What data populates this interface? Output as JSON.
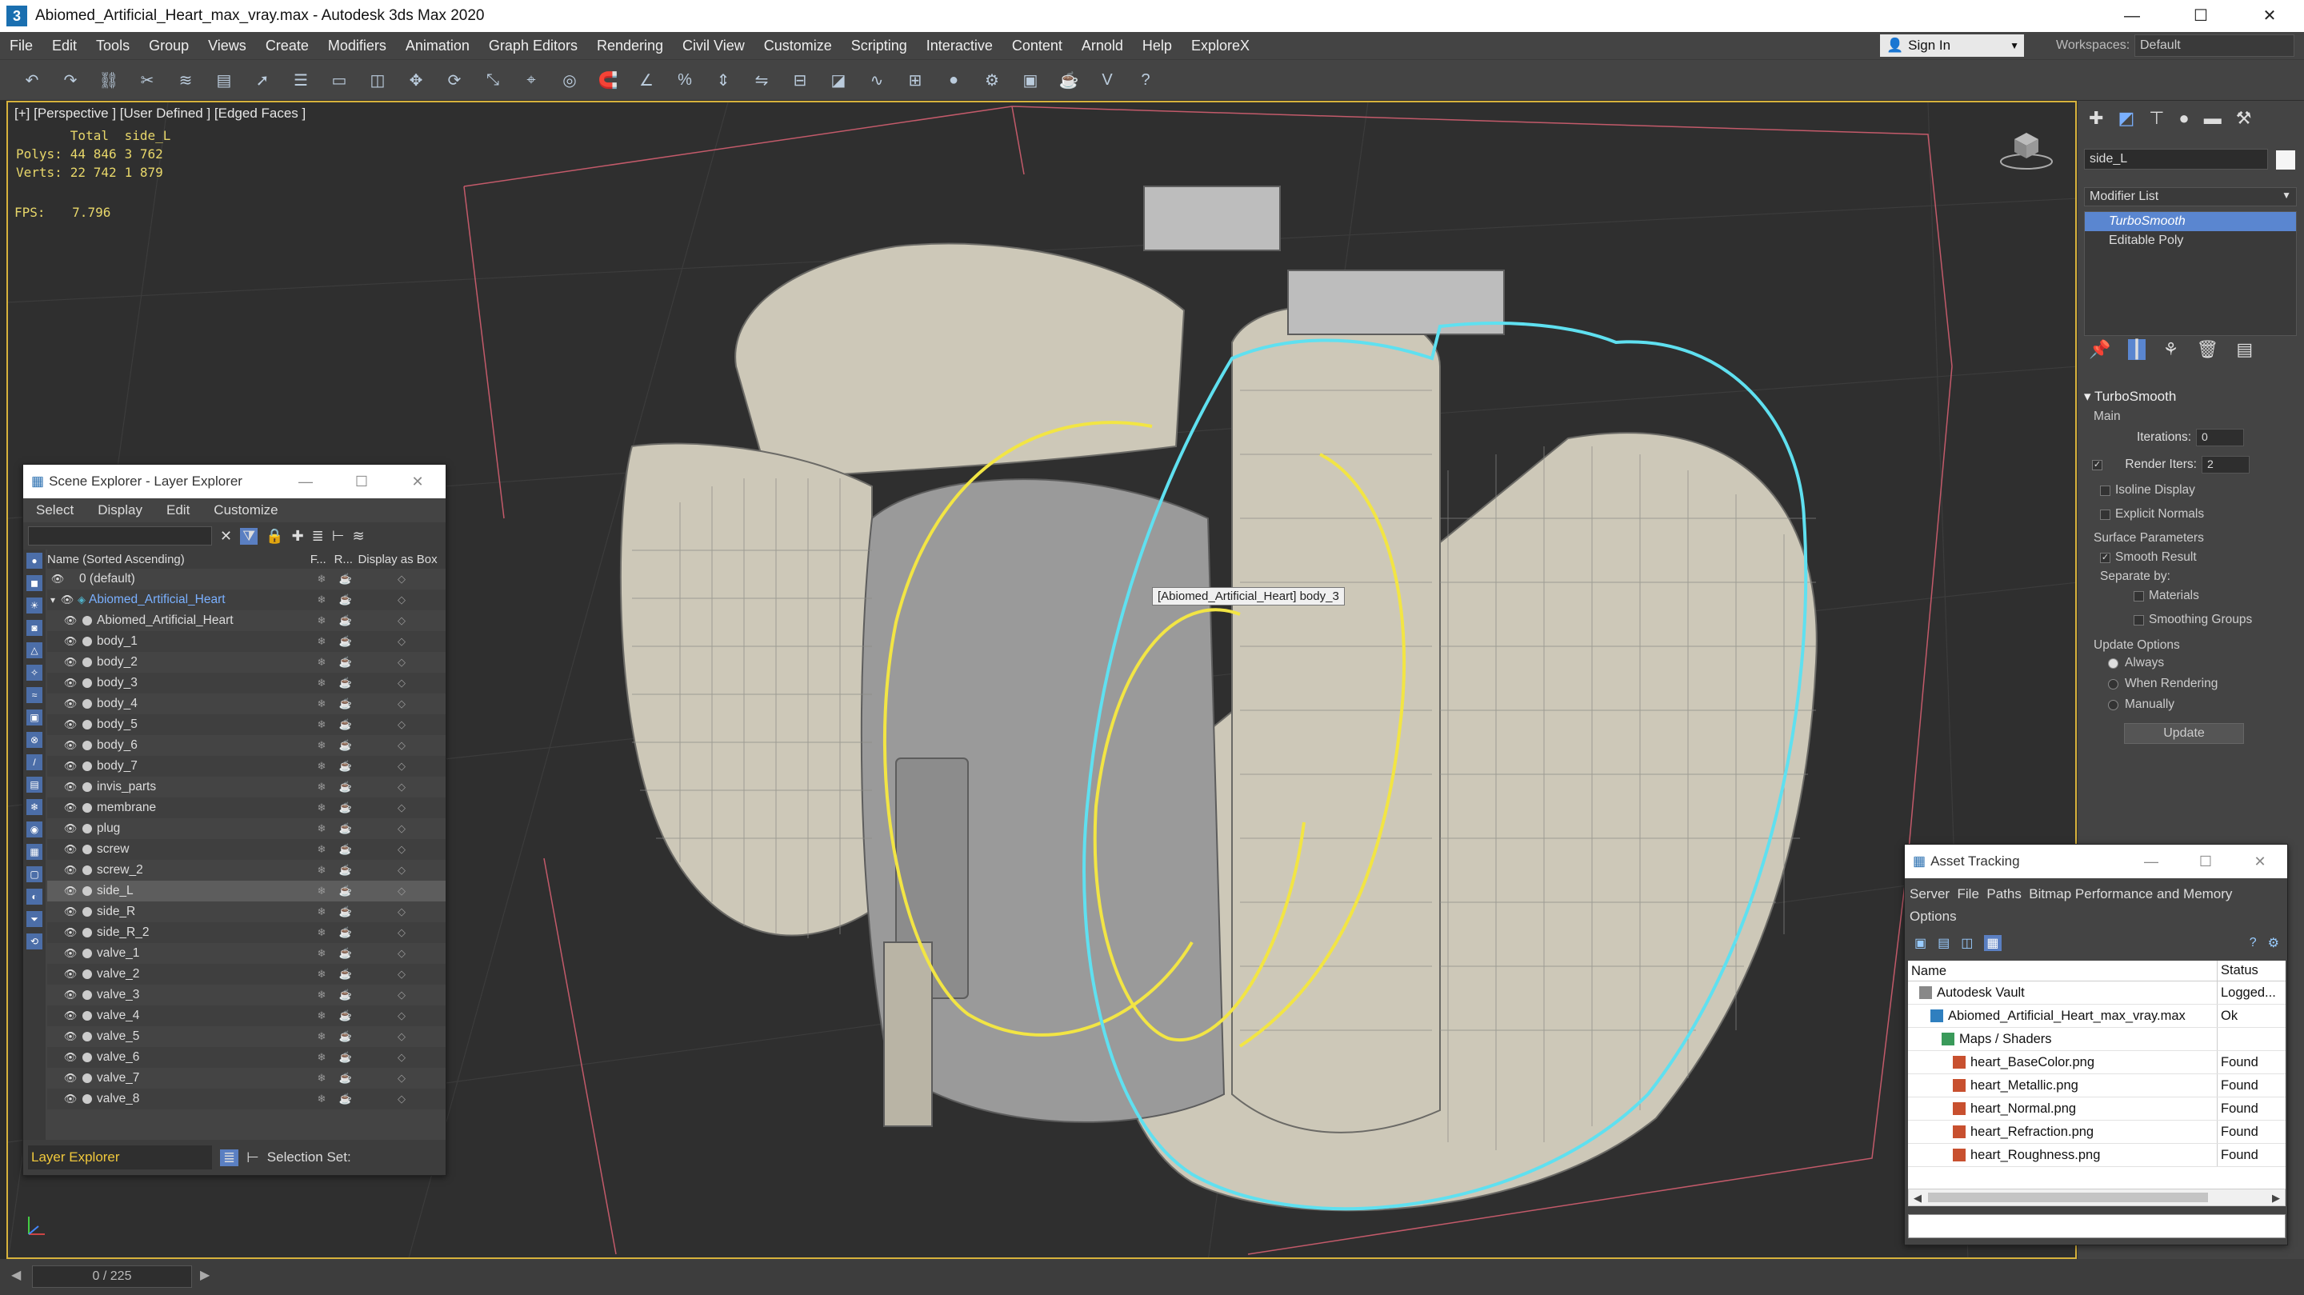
{
  "window": {
    "title": "Abiomed_Artificial_Heart_max_vray.max - Autodesk 3ds Max 2020",
    "app_icon": "3",
    "controls": [
      "—",
      "☐",
      "✕"
    ]
  },
  "menu": [
    "File",
    "Edit",
    "Tools",
    "Group",
    "Views",
    "Create",
    "Modifiers",
    "Animation",
    "Graph Editors",
    "Rendering",
    "Civil View",
    "Customize",
    "Scripting",
    "Interactive",
    "Content",
    "Arnold",
    "Help",
    "ExploreX"
  ],
  "signin": {
    "label": "Sign In"
  },
  "workspaces": {
    "label": "Workspaces:",
    "value": "Default"
  },
  "viewport": {
    "label": "[+] [Perspective ] [User Defined ] [Edged Faces ]",
    "stats": {
      "col_total": "Total",
      "col_sel": "side_L",
      "polys_label": "Polys:",
      "polys_total": "44 846",
      "polys_sel": "3 762",
      "verts_label": "Verts:",
      "verts_total": "22 742",
      "verts_sel": "1 879",
      "fps_label": "FPS:",
      "fps_value": "7.796"
    },
    "tooltip": "[Abiomed_Artificial_Heart] body_3"
  },
  "scene_explorer": {
    "title": "Scene Explorer - Layer Explorer",
    "menu": [
      "Select",
      "Display",
      "Edit",
      "Customize"
    ],
    "columns": {
      "name": "Name (Sorted Ascending)",
      "c2": "F...",
      "c3": "R...",
      "c4": "Display as Box"
    },
    "rows": [
      {
        "name": "0 (default)",
        "level": 0,
        "kind": "layer"
      },
      {
        "name": "Abiomed_Artificial_Heart",
        "level": 0,
        "kind": "layer-active"
      },
      {
        "name": "Abiomed_Artificial_Heart",
        "level": 1,
        "kind": "object"
      },
      {
        "name": "body_1",
        "level": 1,
        "kind": "object"
      },
      {
        "name": "body_2",
        "level": 1,
        "kind": "object"
      },
      {
        "name": "body_3",
        "level": 1,
        "kind": "object"
      },
      {
        "name": "body_4",
        "level": 1,
        "kind": "object"
      },
      {
        "name": "body_5",
        "level": 1,
        "kind": "object"
      },
      {
        "name": "body_6",
        "level": 1,
        "kind": "object"
      },
      {
        "name": "body_7",
        "level": 1,
        "kind": "object"
      },
      {
        "name": "invis_parts",
        "level": 1,
        "kind": "object"
      },
      {
        "name": "membrane",
        "level": 1,
        "kind": "object"
      },
      {
        "name": "plug",
        "level": 1,
        "kind": "object"
      },
      {
        "name": "screw",
        "level": 1,
        "kind": "object"
      },
      {
        "name": "screw_2",
        "level": 1,
        "kind": "object"
      },
      {
        "name": "side_L",
        "level": 1,
        "kind": "object",
        "selected": true
      },
      {
        "name": "side_R",
        "level": 1,
        "kind": "object"
      },
      {
        "name": "side_R_2",
        "level": 1,
        "kind": "object"
      },
      {
        "name": "valve_1",
        "level": 1,
        "kind": "object"
      },
      {
        "name": "valve_2",
        "level": 1,
        "kind": "object"
      },
      {
        "name": "valve_3",
        "level": 1,
        "kind": "object"
      },
      {
        "name": "valve_4",
        "level": 1,
        "kind": "object"
      },
      {
        "name": "valve_5",
        "level": 1,
        "kind": "object"
      },
      {
        "name": "valve_6",
        "level": 1,
        "kind": "object"
      },
      {
        "name": "valve_7",
        "level": 1,
        "kind": "object"
      },
      {
        "name": "valve_8",
        "level": 1,
        "kind": "object"
      }
    ],
    "explorer_select": "Layer Explorer",
    "selection_set_label": "Selection Set:"
  },
  "command_panel": {
    "object_name": "side_L",
    "modifier_list_label": "Modifier List",
    "stack": [
      "TurboSmooth",
      "Editable Poly"
    ],
    "rollout_title": "TurboSmooth",
    "main_label": "Main",
    "iterations_label": "Iterations:",
    "iterations_value": "0",
    "render_iters_label": "Render Iters:",
    "render_iters_value": "2",
    "isoline": "Isoline Display",
    "explicit_normals": "Explicit Normals",
    "surface_params": "Surface Parameters",
    "smooth_result": "Smooth Result",
    "separate_by": "Separate by:",
    "materials": "Materials",
    "smoothing_groups": "Smoothing Groups",
    "update_options": "Update Options",
    "always": "Always",
    "when_rendering": "When Rendering",
    "manually": "Manually",
    "update_button": "Update"
  },
  "asset_tracking": {
    "title": "Asset Tracking",
    "menu": "Server  File  Paths  Bitmap Performance and Memory",
    "menu2": "Options",
    "col_name": "Name",
    "col_status": "Status",
    "rows": [
      {
        "name": "Autodesk Vault",
        "status": "Logged...",
        "indent": 1,
        "icon": "vault"
      },
      {
        "name": "Abiomed_Artificial_Heart_max_vray.max",
        "status": "Ok",
        "indent": 2,
        "icon": "file"
      },
      {
        "name": "Maps / Shaders",
        "status": "",
        "indent": 3,
        "icon": "maps"
      },
      {
        "name": "heart_BaseColor.png",
        "status": "Found",
        "indent": 4,
        "icon": "image"
      },
      {
        "name": "heart_Metallic.png",
        "status": "Found",
        "indent": 4,
        "icon": "image"
      },
      {
        "name": "heart_Normal.png",
        "status": "Found",
        "indent": 4,
        "icon": "image"
      },
      {
        "name": "heart_Refraction.png",
        "status": "Found",
        "indent": 4,
        "icon": "image"
      },
      {
        "name": "heart_Roughness.png",
        "status": "Found",
        "indent": 4,
        "icon": "image"
      }
    ]
  },
  "status": {
    "frame": "0 / 225"
  },
  "colors": {
    "selection_yellow": "#f2e544",
    "selection_cyan": "#5fe0f0",
    "viewport_border": "#d7b23c",
    "accent_blue": "#5a86d0"
  }
}
